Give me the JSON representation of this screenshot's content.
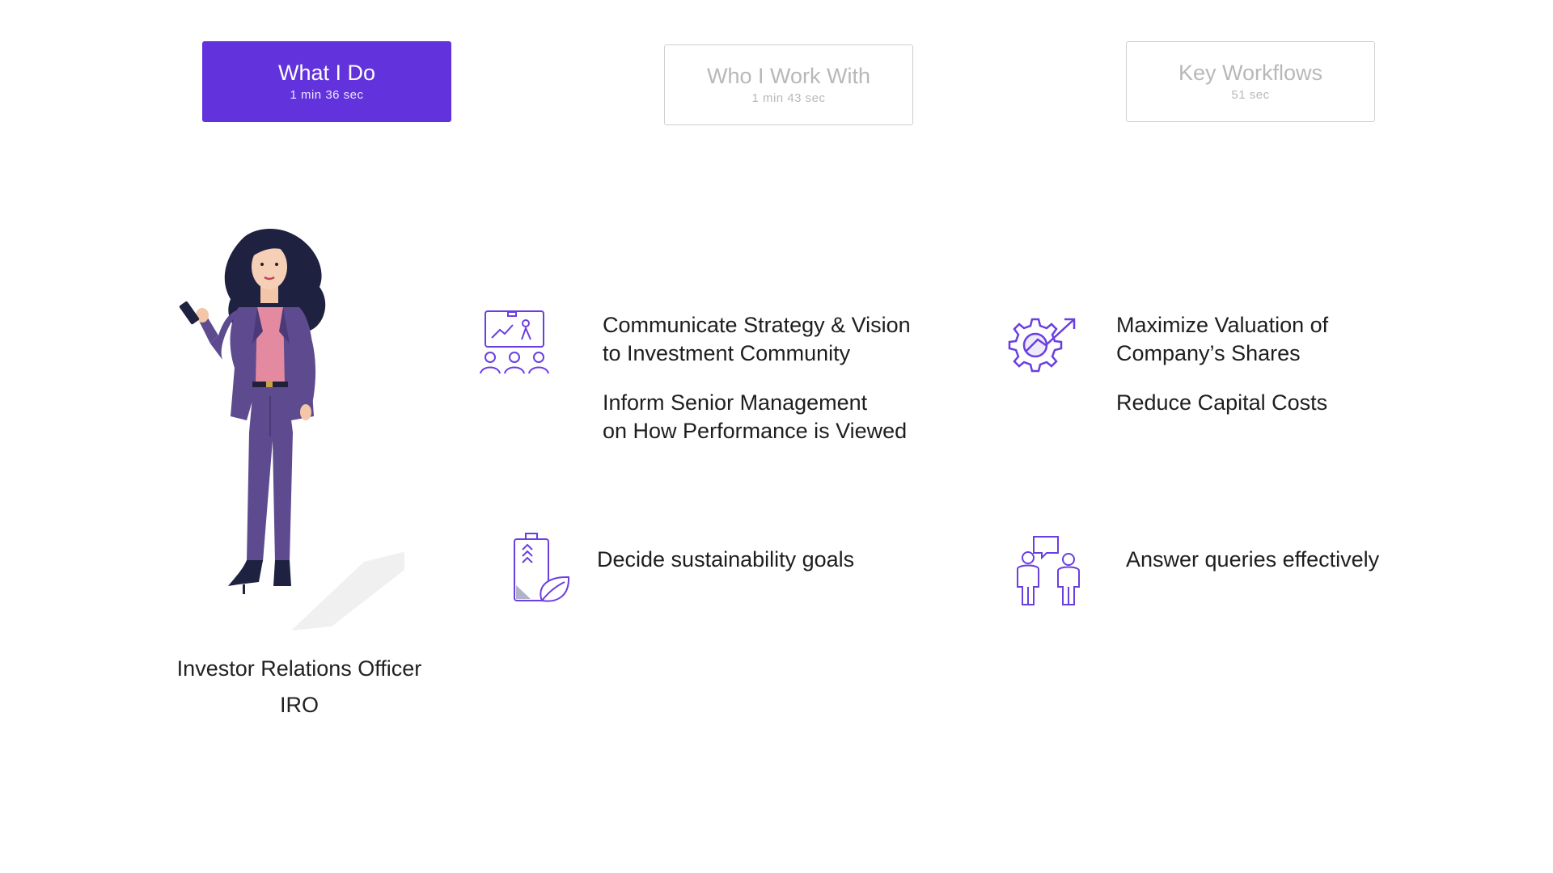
{
  "tabs": [
    {
      "title": "What I Do",
      "duration": "1 min 36 sec",
      "active": true
    },
    {
      "title": "Who I Work With",
      "duration": "1 min 43 sec",
      "active": false
    },
    {
      "title": "Key Workflows",
      "duration": "51 sec",
      "active": false
    }
  ],
  "persona": {
    "name": "Investor Relations Officer",
    "abbreviation": "IRO"
  },
  "features": {
    "strategy": {
      "icon": "presentation-audience-icon",
      "lines": [
        "Communicate Strategy & Vision",
        "to Investment Community",
        "Inform Senior Management",
        "on How Performance is Viewed"
      ]
    },
    "valuation": {
      "icon": "gear-growth-icon",
      "lines": [
        "Maximize Valuation of",
        "Company’s Shares",
        "Reduce Capital Costs"
      ]
    },
    "sustainability": {
      "icon": "battery-leaf-icon",
      "lines": [
        "Decide sustainability goals"
      ]
    },
    "queries": {
      "icon": "people-chat-icon",
      "lines": [
        "Answer queries effectively"
      ]
    }
  },
  "colors": {
    "accent": "#6233dc",
    "icon_purple": "#6a3fe0",
    "suit": "#5e4a8f",
    "top": "#e48aa0"
  }
}
